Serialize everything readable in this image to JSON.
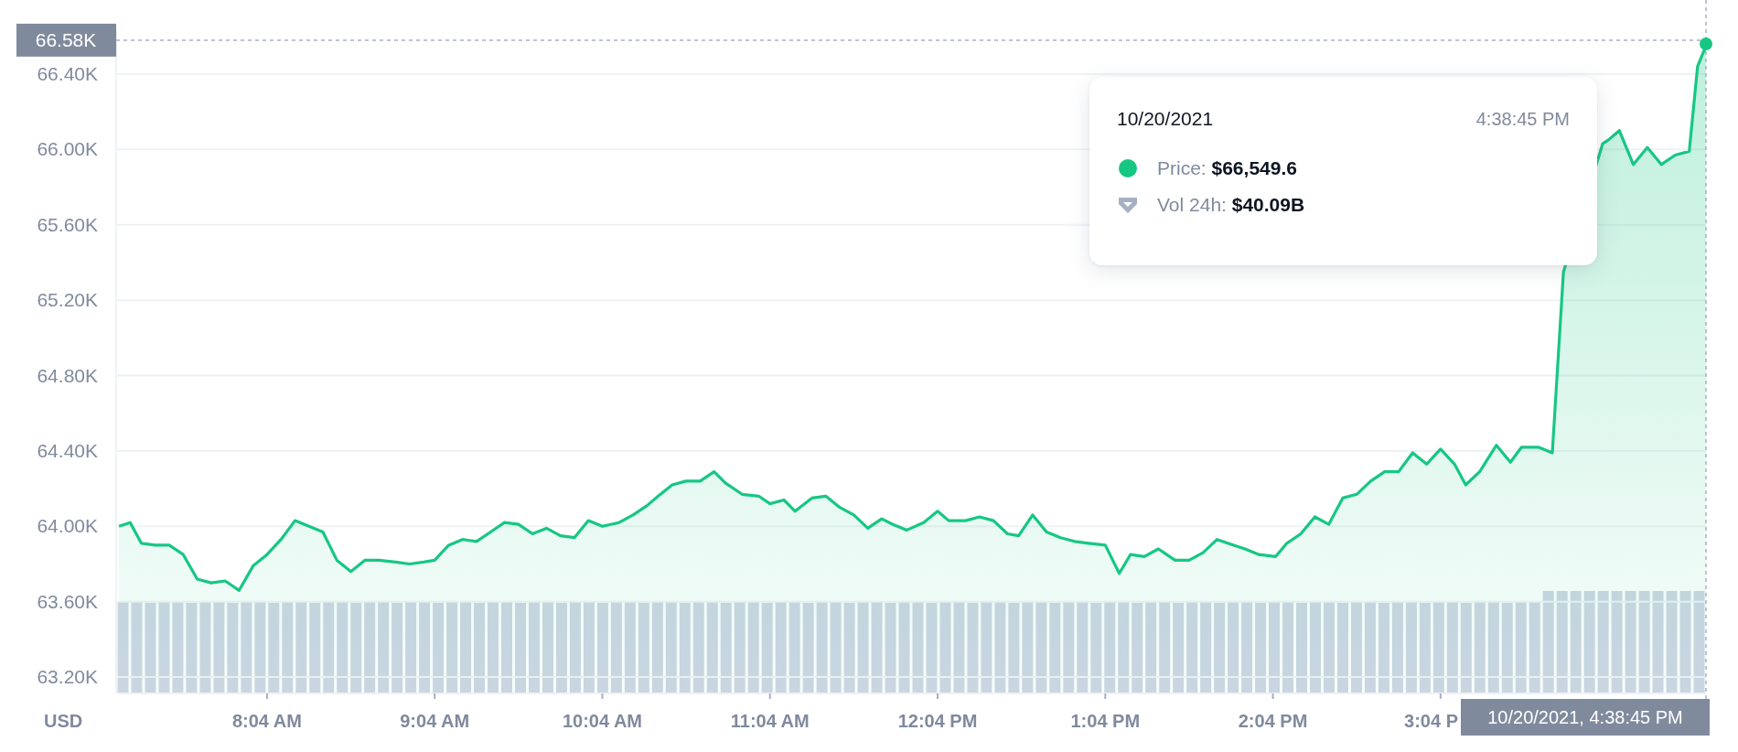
{
  "chart": {
    "chart_data": {
      "type": "area",
      "grid": true,
      "x": [
        431,
        435,
        439,
        444,
        449,
        454,
        459,
        464,
        469,
        474,
        479,
        484,
        489,
        494,
        504,
        509,
        514,
        519,
        524,
        530,
        535,
        540,
        544,
        549,
        554,
        559,
        564,
        569,
        574,
        579,
        584,
        589,
        594,
        599,
        604,
        610,
        615,
        620,
        624,
        629,
        634,
        639,
        644,
        648,
        654,
        660,
        664,
        669,
        673,
        679,
        684,
        689,
        694,
        699,
        704,
        708,
        713,
        719,
        724,
        728,
        734,
        739,
        744,
        749,
        753,
        758,
        763,
        768,
        773,
        778,
        784,
        789,
        793,
        798,
        803,
        809,
        814,
        819,
        824,
        830,
        834,
        839,
        845,
        849,
        854,
        859,
        864,
        869,
        874,
        879,
        884,
        889,
        894,
        899,
        904,
        909,
        913,
        918,
        924,
        929,
        933,
        939,
        944,
        948,
        962,
        964,
        968,
        973,
        978,
        983,
        988,
        993,
        996,
        999
      ],
      "series": [
        {
          "color": "#16c784",
          "values": [
            64000,
            64020,
            63910,
            63900,
            63900,
            63850,
            63720,
            63700,
            63710,
            63660,
            63790,
            63850,
            63930,
            64030,
            63970,
            63820,
            63760,
            63820,
            63820,
            63810,
            63800,
            63810,
            63820,
            63900,
            63930,
            63920,
            63970,
            64020,
            64010,
            63960,
            63990,
            63950,
            63940,
            64030,
            64000,
            64020,
            64060,
            64110,
            64160,
            64220,
            64240,
            64240,
            64290,
            64230,
            64170,
            64160,
            64120,
            64140,
            64080,
            64150,
            64160,
            64100,
            64060,
            63990,
            64040,
            64010,
            63980,
            64020,
            64080,
            64030,
            64030,
            64050,
            64030,
            63960,
            63950,
            64060,
            63970,
            63940,
            63920,
            63910,
            63900,
            63750,
            63850,
            63840,
            63880,
            63820,
            63820,
            63860,
            63930,
            63900,
            63880,
            63850,
            63840,
            63910,
            63960,
            64050,
            64010,
            64150,
            64170,
            64240,
            64290,
            64290,
            64390,
            64330,
            64410,
            64330,
            64220,
            64290,
            64430,
            64340,
            64420,
            64420,
            64390,
            65350,
            66030,
            66050,
            66100,
            65920,
            66010,
            65920,
            65970,
            65990,
            66440,
            66550
          ]
        }
      ],
      "xlim": [
        430,
        999
      ],
      "ylim": [
        63113,
        66628
      ],
      "xticks": [
        {
          "value": 484,
          "label": "8:04 AM"
        },
        {
          "value": 544,
          "label": "9:04 AM"
        },
        {
          "value": 604,
          "label": "10:04 AM"
        },
        {
          "value": 664,
          "label": "11:04 AM"
        },
        {
          "value": 724,
          "label": "12:04 PM"
        },
        {
          "value": 784,
          "label": "1:04 PM"
        },
        {
          "value": 844,
          "label": "2:04 PM"
        },
        {
          "value": 904,
          "label": "3:04 P"
        }
      ],
      "yticks": [
        {
          "value": 63200,
          "label": "63.20K"
        },
        {
          "value": 63600,
          "label": "63.60K"
        },
        {
          "value": 64000,
          "label": "64.00K"
        },
        {
          "value": 64400,
          "label": "64.40K"
        },
        {
          "value": 64800,
          "label": "64.80K"
        },
        {
          "value": 65200,
          "label": "65.20K"
        },
        {
          "value": 65600,
          "label": "65.60K"
        },
        {
          "value": 66000,
          "label": "66.00K"
        },
        {
          "value": 66400,
          "label": "66.40K"
        }
      ],
      "ref_lines": [
        {
          "axis": "y",
          "value": 66580,
          "label": "66.58K"
        },
        {
          "axis": "x",
          "value": 999
        }
      ]
    },
    "axis_unit": "USD",
    "crosshair": {
      "time_label": "10/20/2021, 4:38:45 PM"
    },
    "tooltip": {
      "date": "10/20/2021",
      "time": "4:38:45 PM",
      "rows": [
        {
          "kind": "price",
          "label": "Price:",
          "value": "$66,549.6"
        },
        {
          "kind": "volume",
          "label": "Vol 24h:",
          "value": "$40.09B"
        }
      ]
    }
  }
}
